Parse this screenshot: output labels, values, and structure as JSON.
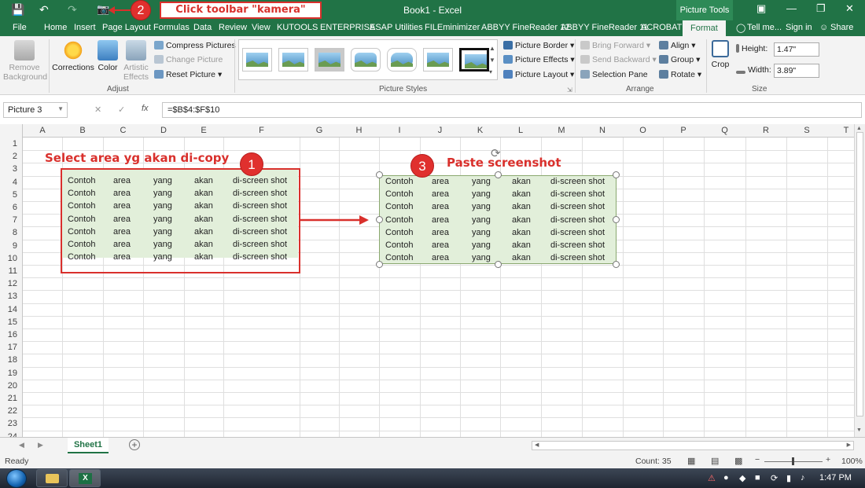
{
  "colors": {
    "excel_green": "#217346",
    "annotation_red": "#d9302c",
    "cell_fill": "#e2efda"
  },
  "titlebar": {
    "title": "Book1 - Excel",
    "picture_tools": "Picture Tools",
    "callout_text": "Click toolbar \"kamera\""
  },
  "tabs": [
    "File",
    "Home",
    "Insert",
    "Page Layout",
    "Formulas",
    "Data",
    "Review",
    "View",
    "KUTOOLS",
    "ENTERPRISE",
    "ASAP Utilities",
    "FILEminimizer",
    "ABBYY FineReader 12",
    "ABBYY FineReader 11",
    "ACROBAT",
    "Format"
  ],
  "tell_me": "Tell me...",
  "sign_in": "Sign in",
  "share": "Share",
  "ribbon": {
    "remove_background": "Remove Background",
    "corrections": "Corrections",
    "color": "Color",
    "artistic_effects": "Artistic Effects",
    "compress_pictures": "Compress Pictures",
    "change_picture": "Change Picture",
    "reset_picture": "Reset Picture",
    "adjust": "Adjust",
    "picture_styles": "Picture Styles",
    "picture_border": "Picture Border",
    "picture_effects": "Picture Effects",
    "picture_layout": "Picture Layout",
    "bring_forward": "Bring Forward",
    "send_backward": "Send Backward",
    "selection_pane": "Selection Pane",
    "align": "Align",
    "group": "Group",
    "rotate": "Rotate",
    "arrange": "Arrange",
    "crop": "Crop",
    "height_label": "Height:",
    "height_value": "1.47\"",
    "width_label": "Width:",
    "width_value": "3.89\"",
    "size": "Size"
  },
  "formula_bar": {
    "name_box": "Picture 3",
    "fx": "fx",
    "formula": "=$B$4:$F$10"
  },
  "columns": [
    "A",
    "B",
    "C",
    "D",
    "E",
    "F",
    "G",
    "H",
    "I",
    "J",
    "K",
    "L",
    "M",
    "N",
    "O",
    "P",
    "Q",
    "R",
    "S",
    "T"
  ],
  "rows": [
    "1",
    "2",
    "3",
    "4",
    "5",
    "6",
    "7",
    "8",
    "9",
    "10",
    "11",
    "12",
    "13",
    "14",
    "15",
    "16",
    "17",
    "18",
    "19",
    "20",
    "21",
    "22",
    "23",
    "24"
  ],
  "table_row": [
    "Contoh",
    "area",
    "yang",
    "akan",
    "di-screen shot"
  ],
  "annotations": {
    "step1": "1",
    "step1_label": "Select area yg akan di-copy",
    "step2": "2",
    "step3": "3",
    "step3_label": "Paste screenshot"
  },
  "sheet_tab": "Sheet1",
  "status": {
    "ready": "Ready",
    "count": "Count: 35",
    "zoom": "100%"
  },
  "taskbar": {
    "time": "1:47 PM"
  }
}
